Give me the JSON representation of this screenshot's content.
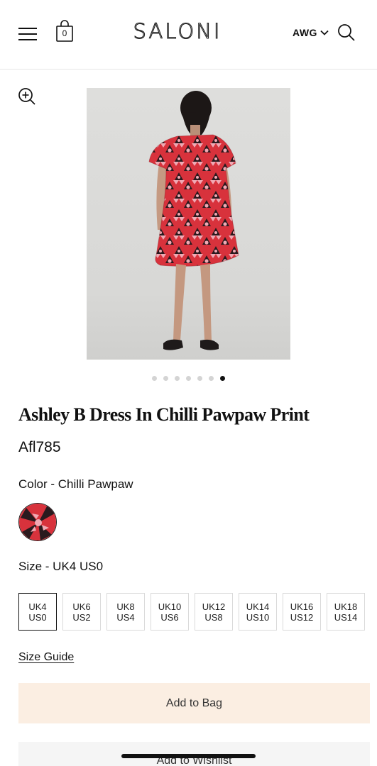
{
  "header": {
    "logo": "SALONI",
    "bag_count": "0",
    "currency": "AWG",
    "icons": {
      "menu": "hamburger-menu-icon",
      "bag": "shopping-bag-icon",
      "search": "search-icon",
      "currency_caret": "chevron-down-icon"
    }
  },
  "gallery": {
    "zoom_icon": "zoom-in-icon",
    "image_count": 7,
    "active_index": 6
  },
  "product": {
    "title": "Ashley B Dress In Chilli Pawpaw Print",
    "price": "Afl785",
    "color_label": "Color - Chilli Pawpaw",
    "size_label": "Size - UK4 US0",
    "sizes": [
      {
        "uk": "UK4",
        "us": "US0",
        "selected": true
      },
      {
        "uk": "UK6",
        "us": "US2",
        "selected": false
      },
      {
        "uk": "UK8",
        "us": "US4",
        "selected": false
      },
      {
        "uk": "UK10",
        "us": "US6",
        "selected": false
      },
      {
        "uk": "UK12",
        "us": "US8",
        "selected": false
      },
      {
        "uk": "UK14",
        "us": "US10",
        "selected": false
      },
      {
        "uk": "UK16",
        "us": "US12",
        "selected": false
      },
      {
        "uk": "UK18",
        "us": "US14",
        "selected": false
      }
    ],
    "size_guide": "Size Guide",
    "add_to_bag": "Add to Bag",
    "add_to_wishlist": "Add to Wishlist"
  },
  "colors": {
    "bag_button_bg": "#fbeee2",
    "wishlist_button_bg": "#f5f5f5",
    "dress_red": "#d8323c",
    "dress_dark": "#2a1a1e",
    "dress_pink": "#f0a9b4"
  }
}
